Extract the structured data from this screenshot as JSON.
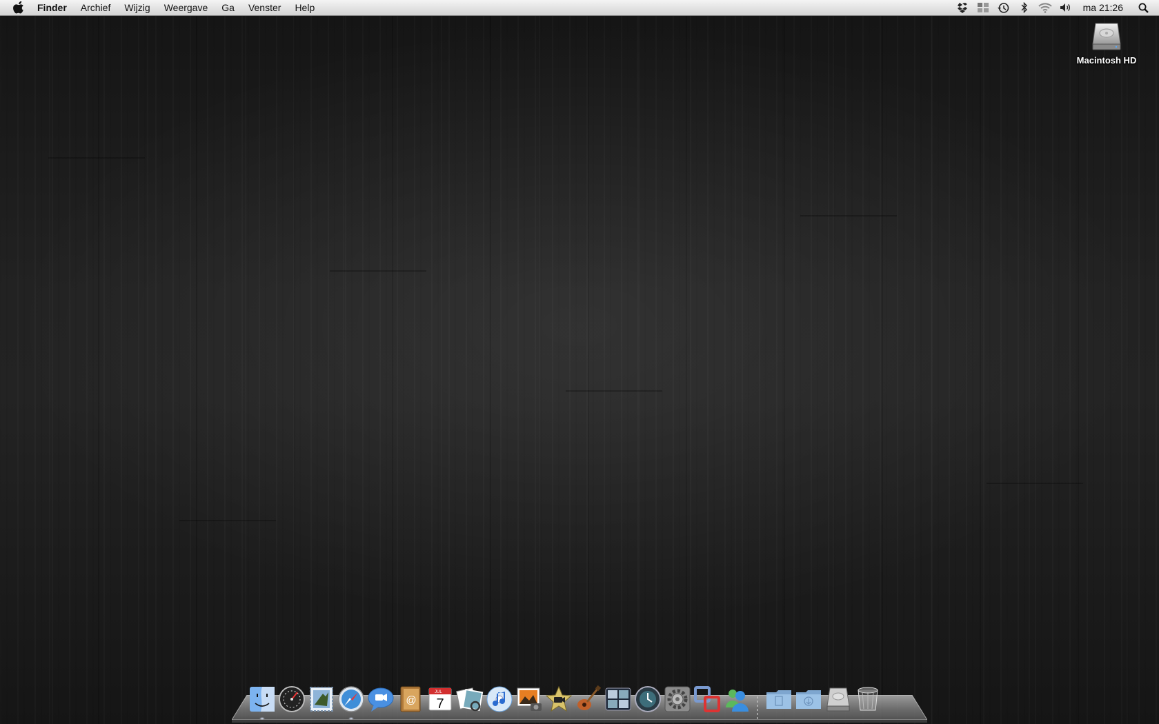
{
  "menubar": {
    "apple_icon": "apple-icon",
    "app_name": "Finder",
    "items": [
      "Archief",
      "Wijzig",
      "Weergave",
      "Ga",
      "Venster",
      "Help"
    ],
    "status_icons": [
      "dropbox-icon",
      "spaces-icon",
      "time-machine-icon",
      "bluetooth-icon",
      "wifi-icon",
      "volume-icon"
    ],
    "clock": "ma 21:26",
    "spotlight_icon": "spotlight-search-icon"
  },
  "desktop": {
    "icons": [
      {
        "label": "Macintosh HD",
        "icon": "hard-drive-icon"
      }
    ]
  },
  "dock": {
    "apps": [
      {
        "icon": "finder-icon",
        "running": true
      },
      {
        "icon": "dashboard-icon",
        "running": false
      },
      {
        "icon": "mail-icon",
        "running": false
      },
      {
        "icon": "safari-icon",
        "running": true
      },
      {
        "icon": "ichat-icon",
        "running": false
      },
      {
        "icon": "address-book-icon",
        "running": false
      },
      {
        "icon": "ical-icon",
        "running": false
      },
      {
        "icon": "preview-icon",
        "running": false
      },
      {
        "icon": "itunes-icon",
        "running": false
      },
      {
        "icon": "iphoto-icon",
        "running": false
      },
      {
        "icon": "imovie-icon",
        "running": false
      },
      {
        "icon": "garageband-icon",
        "running": false
      },
      {
        "icon": "spaces-app-icon",
        "running": false
      },
      {
        "icon": "time-machine-app-icon",
        "running": false
      },
      {
        "icon": "system-preferences-icon",
        "running": false
      },
      {
        "icon": "vmware-icon",
        "running": false
      },
      {
        "icon": "messenger-icon",
        "running": false
      }
    ],
    "stacks": [
      {
        "icon": "documents-folder-icon"
      },
      {
        "icon": "downloads-folder-icon"
      },
      {
        "icon": "hard-drive-stack-icon"
      },
      {
        "icon": "trash-icon"
      }
    ],
    "ical_day": "7",
    "ical_month": "JUL"
  },
  "colors": {
    "menubar_top": "#f4f4f4",
    "menubar_bottom": "#d4d4d4",
    "wallpaper": "#1e1e1e",
    "folder_blue": "#8fb4d9"
  }
}
